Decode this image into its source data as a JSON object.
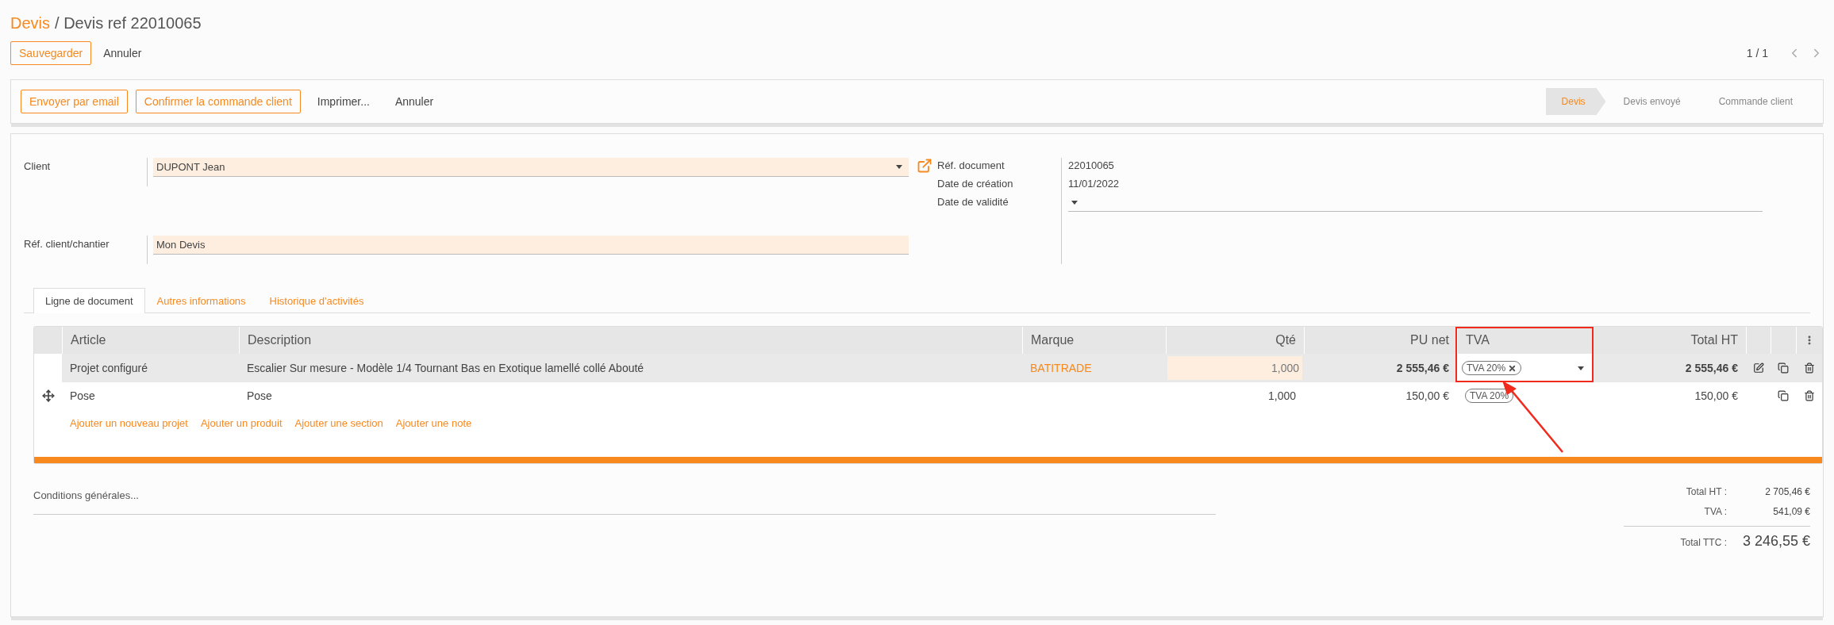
{
  "breadcrumb": [
    {
      "label": "Devis",
      "link": true
    },
    {
      "label": "/ Devis ref 22010065",
      "link": false
    }
  ],
  "top_buttons": [
    {
      "label": "Sauvegarder",
      "kind": "primary"
    },
    {
      "label": "Annuler",
      "kind": "plain"
    }
  ],
  "pager": {
    "label": "1 / 1"
  },
  "actions": [
    {
      "label": "Envoyer par email",
      "kind": "primary"
    },
    {
      "label": "Confirmer la commande client",
      "kind": "primary"
    },
    {
      "label": "Imprimer...",
      "kind": "plain"
    },
    {
      "label": "Annuler",
      "kind": "plain"
    }
  ],
  "steps": [
    {
      "label": "Devis",
      "selected": true
    },
    {
      "label": "Devis envoyé",
      "selected": false
    },
    {
      "label": "Commande client",
      "selected": false
    }
  ],
  "fields_left": [
    {
      "label": "Client",
      "value": "DUPONT Jean",
      "kind": "select"
    },
    {
      "label": "Réf. client/chantier",
      "value": "Mon Devis",
      "kind": "text"
    }
  ],
  "fields_right": [
    {
      "label": "Réf. document",
      "value": "22010065",
      "kind": "static"
    },
    {
      "label": "Date de création",
      "value": "11/01/2022",
      "kind": "static"
    },
    {
      "label": "Date de validité",
      "kind": "select"
    }
  ],
  "tabs": [
    {
      "label": "Ligne de document",
      "selected": true
    },
    {
      "label": "Autres informations",
      "selected": false
    },
    {
      "label": "Historique d'activités",
      "selected": false
    }
  ],
  "table": {
    "columns": [
      {
        "label": "Article",
        "kind": "text",
        "highlighted": false
      },
      {
        "label": "Description",
        "kind": "text",
        "highlighted": false
      },
      {
        "label": "Marque",
        "kind": "link",
        "highlighted": false
      },
      {
        "label": "Qté",
        "kind": "number",
        "highlighted": false
      },
      {
        "label": "PU net",
        "kind": "money",
        "highlighted": false
      },
      {
        "label": "TVA",
        "kind": "tag",
        "highlighted": true
      },
      {
        "label": "Total HT",
        "kind": "money",
        "highlighted": false
      }
    ],
    "rows": [
      {
        "selected": true,
        "drag_handle": false,
        "cells": [
          "Projet configuré",
          "Escalier Sur mesure - Modèle 1/4 Tournant Bas en Exotique lamellé collé Abouté",
          "BATITRADE",
          "1,000",
          "2 555,46 €",
          "TVA 20%",
          "2 555,46 €"
        ],
        "actions": [
          {
            "kind": "edit"
          },
          {
            "kind": "copy"
          },
          {
            "kind": "delete"
          }
        ]
      },
      {
        "selected": false,
        "drag_handle": true,
        "cells": [
          "Pose",
          "Pose",
          null,
          "1,000",
          "150,00 €",
          "TVA 20%",
          "150,00 €"
        ],
        "actions": [
          {
            "kind": "copy"
          },
          {
            "kind": "delete"
          }
        ]
      }
    ],
    "links": [
      "Ajouter un nouveau projet",
      "Ajouter un produit",
      "Ajouter une section",
      "Ajouter une note"
    ]
  },
  "conditions": {
    "placeholder": "Conditions générales..."
  },
  "totals": [
    {
      "label": "Total HT :",
      "value": "2 705,46 €",
      "kind": "sub"
    },
    {
      "label": "TVA :",
      "value": "541,09 €",
      "kind": "sub"
    },
    {
      "label": "Total TTC :",
      "value": "3 246,55 €",
      "kind": "grand"
    }
  ]
}
